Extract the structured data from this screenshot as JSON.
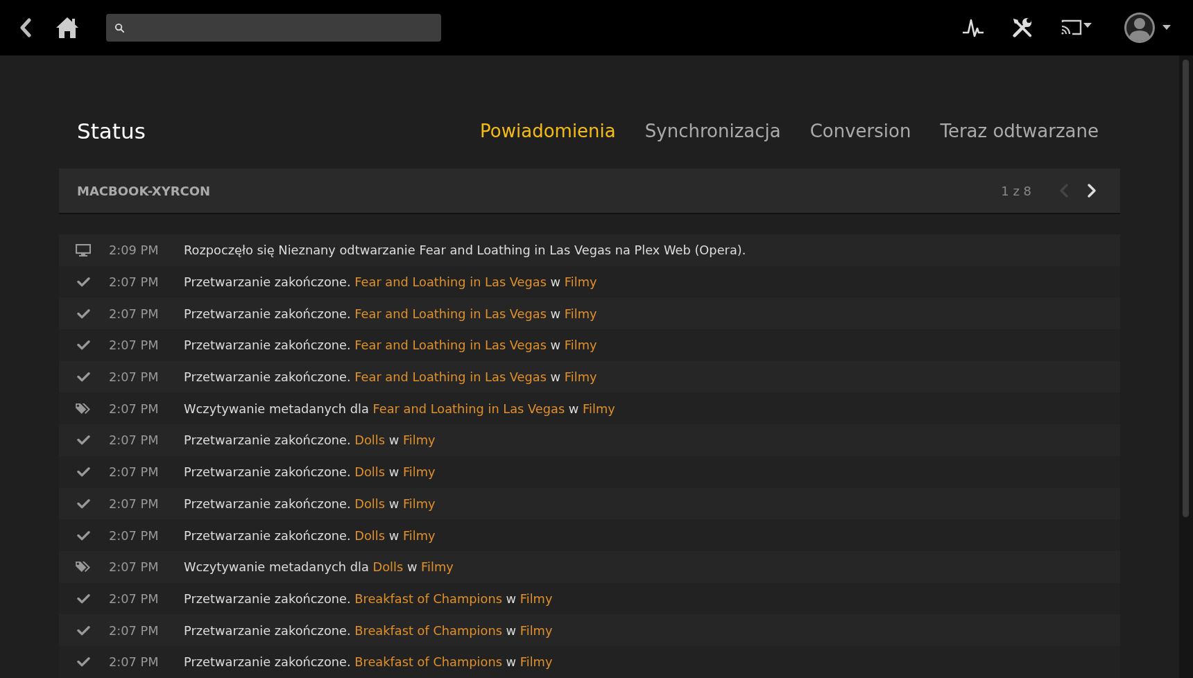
{
  "page": {
    "title": "Status"
  },
  "tabs": [
    {
      "label": "Powiadomienia",
      "selected": true
    },
    {
      "label": "Synchronizacja",
      "selected": false
    },
    {
      "label": "Conversion",
      "selected": false
    },
    {
      "label": "Teraz odtwarzane",
      "selected": false
    }
  ],
  "device_header": {
    "name": "MACBOOK-XYRCON",
    "pager": "1 z 8",
    "prev_disabled": true,
    "next_disabled": false
  },
  "notifications": [
    {
      "kind": "playback",
      "time": "2:09 PM",
      "parts": [
        {
          "kind": "text",
          "text": "Rozpoczęło się Nieznany odtwarzanie Fear and Loathing in Las Vegas na Plex Web (Opera)."
        }
      ]
    },
    {
      "kind": "done",
      "time": "2:07 PM",
      "parts": [
        {
          "kind": "text",
          "text": "Przetwarzanie zakończone. "
        },
        {
          "kind": "link",
          "text": "Fear and Loathing in Las Vegas"
        },
        {
          "kind": "text",
          "text": " w "
        },
        {
          "kind": "link",
          "text": "Filmy"
        }
      ]
    },
    {
      "kind": "done",
      "time": "2:07 PM",
      "parts": [
        {
          "kind": "text",
          "text": "Przetwarzanie zakończone. "
        },
        {
          "kind": "link",
          "text": "Fear and Loathing in Las Vegas"
        },
        {
          "kind": "text",
          "text": " w "
        },
        {
          "kind": "link",
          "text": "Filmy"
        }
      ]
    },
    {
      "kind": "done",
      "time": "2:07 PM",
      "parts": [
        {
          "kind": "text",
          "text": "Przetwarzanie zakończone. "
        },
        {
          "kind": "link",
          "text": "Fear and Loathing in Las Vegas"
        },
        {
          "kind": "text",
          "text": " w "
        },
        {
          "kind": "link",
          "text": "Filmy"
        }
      ]
    },
    {
      "kind": "done",
      "time": "2:07 PM",
      "parts": [
        {
          "kind": "text",
          "text": "Przetwarzanie zakończone. "
        },
        {
          "kind": "link",
          "text": "Fear and Loathing in Las Vegas"
        },
        {
          "kind": "text",
          "text": " w "
        },
        {
          "kind": "link",
          "text": "Filmy"
        }
      ]
    },
    {
      "kind": "metadata",
      "time": "2:07 PM",
      "parts": [
        {
          "kind": "text",
          "text": "Wczytywanie metadanych dla "
        },
        {
          "kind": "link",
          "text": "Fear and Loathing in Las Vegas"
        },
        {
          "kind": "text",
          "text": " w "
        },
        {
          "kind": "link",
          "text": "Filmy"
        }
      ]
    },
    {
      "kind": "done",
      "time": "2:07 PM",
      "parts": [
        {
          "kind": "text",
          "text": "Przetwarzanie zakończone. "
        },
        {
          "kind": "link",
          "text": "Dolls"
        },
        {
          "kind": "text",
          "text": " w "
        },
        {
          "kind": "link",
          "text": "Filmy"
        }
      ]
    },
    {
      "kind": "done",
      "time": "2:07 PM",
      "parts": [
        {
          "kind": "text",
          "text": "Przetwarzanie zakończone. "
        },
        {
          "kind": "link",
          "text": "Dolls"
        },
        {
          "kind": "text",
          "text": " w "
        },
        {
          "kind": "link",
          "text": "Filmy"
        }
      ]
    },
    {
      "kind": "done",
      "time": "2:07 PM",
      "parts": [
        {
          "kind": "text",
          "text": "Przetwarzanie zakończone. "
        },
        {
          "kind": "link",
          "text": "Dolls"
        },
        {
          "kind": "text",
          "text": " w "
        },
        {
          "kind": "link",
          "text": "Filmy"
        }
      ]
    },
    {
      "kind": "done",
      "time": "2:07 PM",
      "parts": [
        {
          "kind": "text",
          "text": "Przetwarzanie zakończone. "
        },
        {
          "kind": "link",
          "text": "Dolls"
        },
        {
          "kind": "text",
          "text": " w "
        },
        {
          "kind": "link",
          "text": "Filmy"
        }
      ]
    },
    {
      "kind": "metadata",
      "time": "2:07 PM",
      "parts": [
        {
          "kind": "text",
          "text": "Wczytywanie metadanych dla "
        },
        {
          "kind": "link",
          "text": "Dolls"
        },
        {
          "kind": "text",
          "text": " w "
        },
        {
          "kind": "link",
          "text": "Filmy"
        }
      ]
    },
    {
      "kind": "done",
      "time": "2:07 PM",
      "parts": [
        {
          "kind": "text",
          "text": "Przetwarzanie zakończone. "
        },
        {
          "kind": "link",
          "text": "Breakfast of Champions"
        },
        {
          "kind": "text",
          "text": " w "
        },
        {
          "kind": "link",
          "text": "Filmy"
        }
      ]
    },
    {
      "kind": "done",
      "time": "2:07 PM",
      "parts": [
        {
          "kind": "text",
          "text": "Przetwarzanie zakończone. "
        },
        {
          "kind": "link",
          "text": "Breakfast of Champions"
        },
        {
          "kind": "text",
          "text": " w "
        },
        {
          "kind": "link",
          "text": "Filmy"
        }
      ]
    },
    {
      "kind": "done",
      "time": "2:07 PM",
      "parts": [
        {
          "kind": "text",
          "text": "Przetwarzanie zakończone. "
        },
        {
          "kind": "link",
          "text": "Breakfast of Champions"
        },
        {
          "kind": "text",
          "text": " w "
        },
        {
          "kind": "link",
          "text": "Filmy"
        }
      ]
    }
  ]
}
